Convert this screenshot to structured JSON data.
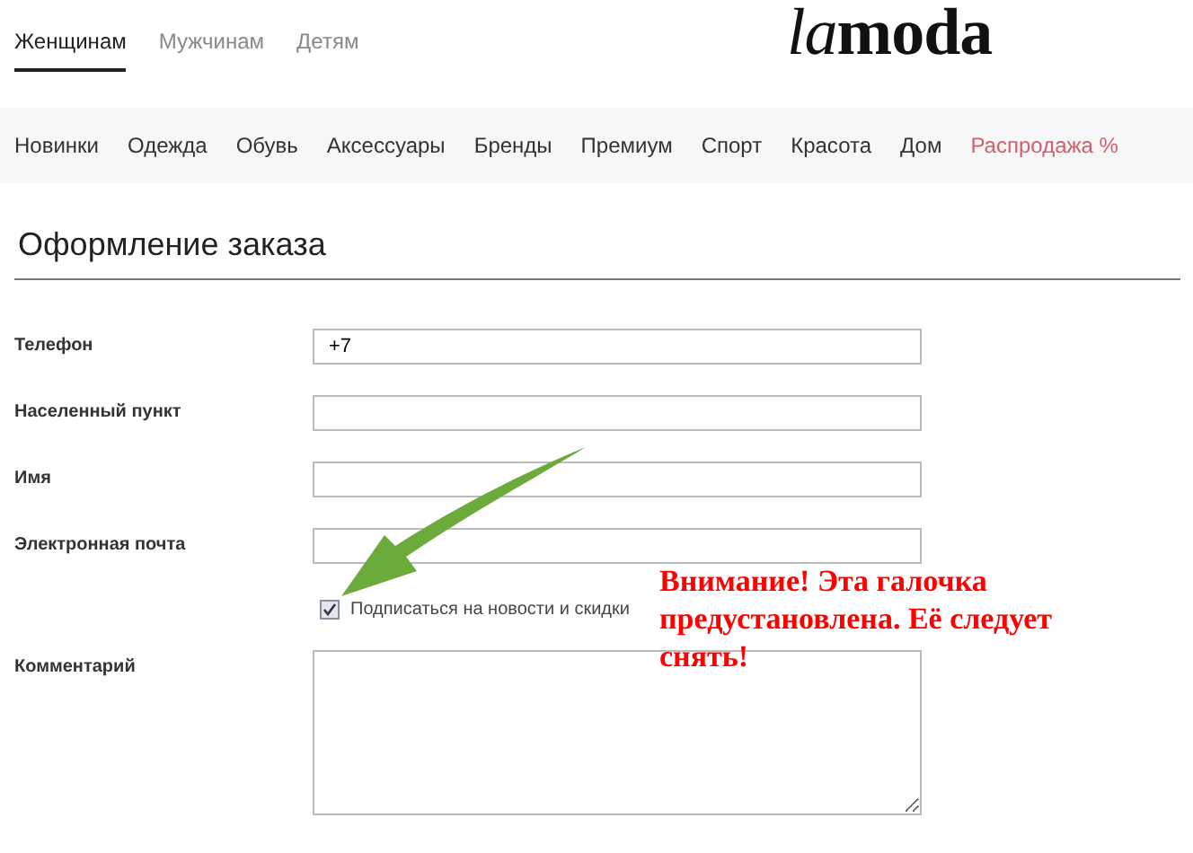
{
  "gender_tabs": [
    {
      "label": "Женщинам",
      "selected": true
    },
    {
      "label": "Мужчинам",
      "selected": false
    },
    {
      "label": "Детям",
      "selected": false
    }
  ],
  "logo": {
    "italic": "la",
    "bold": "moda"
  },
  "nav": [
    {
      "label": "Новинки",
      "sale": false
    },
    {
      "label": "Одежда",
      "sale": false
    },
    {
      "label": "Обувь",
      "sale": false
    },
    {
      "label": "Аксессуары",
      "sale": false
    },
    {
      "label": "Бренды",
      "sale": false
    },
    {
      "label": "Премиум",
      "sale": false
    },
    {
      "label": "Спорт",
      "sale": false
    },
    {
      "label": "Красота",
      "sale": false
    },
    {
      "label": "Дом",
      "sale": false
    },
    {
      "label": "Распродажа %",
      "sale": true
    }
  ],
  "heading": "Оформление заказа",
  "form": [
    {
      "kind": "text",
      "label": "Телефон",
      "value": "+7"
    },
    {
      "kind": "text",
      "label": "Населенный пункт"
    },
    {
      "kind": "text",
      "label": "Имя"
    },
    {
      "kind": "text",
      "label": "Электронная почта"
    },
    {
      "kind": "checkbox",
      "label": "Подписаться на новости и скидки",
      "checked": true
    },
    {
      "kind": "textarea",
      "label": "Комментарий"
    }
  ],
  "annotation": "Внимание! Эта галочка предустановлена. Её следует снять!"
}
